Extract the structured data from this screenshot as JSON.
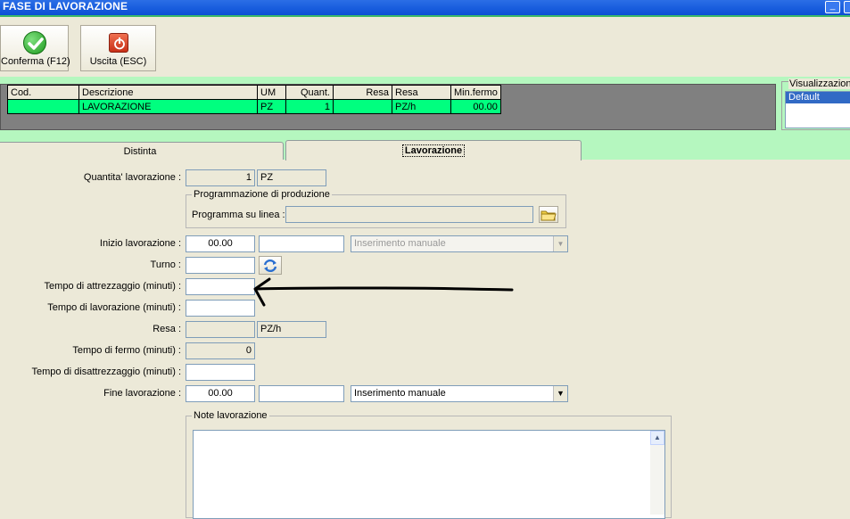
{
  "window": {
    "title": "FASE DI LAVORAZIONE"
  },
  "toolbar": {
    "confirm_label": "Conferma (F12)",
    "exit_label": "Uscita (ESC)"
  },
  "grid": {
    "headers": [
      "Cod.",
      "Descrizione",
      "UM",
      "Quant.",
      "Resa",
      "Resa",
      "Min.fermo"
    ],
    "row": {
      "cod": "",
      "descrizione": "LAVORAZIONE",
      "um": "PZ",
      "quant": "1",
      "resa": "",
      "resa_um": "PZ/h",
      "min_fermo": "00.00"
    }
  },
  "visualizzazione": {
    "label": "Visualizzazione",
    "selected": "Default"
  },
  "tabs": [
    {
      "label": "Distinta"
    },
    {
      "label": "Lavorazione"
    }
  ],
  "form": {
    "quantita_label": "Quantita' lavorazione :",
    "quantita_value": "1",
    "quantita_um": "PZ",
    "programmazione_legend": "Programmazione di produzione",
    "programma_label": "Programma su linea :",
    "programma_value": "",
    "inizio_label": "Inizio lavorazione :",
    "inizio_time": "00.00",
    "inizio_date": "",
    "inizio_mode": "Inserimento manuale",
    "turno_label": "Turno :",
    "turno_value": "",
    "attrezzaggio_label": "Tempo di attrezzaggio (minuti) :",
    "attrezzaggio_value": "",
    "lavorazione_label": "Tempo di lavorazione (minuti) :",
    "lavorazione_value": "",
    "resa_label": "Resa :",
    "resa_value": "",
    "resa_um": "PZ/h",
    "fermo_label": "Tempo di fermo (minuti) :",
    "fermo_value": "0",
    "disattrezzaggio_label": "Tempo di disattrezzaggio (minuti) :",
    "disattrezzaggio_value": "",
    "fine_label": "Fine lavorazione :",
    "fine_time": "00.00",
    "fine_date": "",
    "fine_mode": "Inserimento manuale",
    "note_legend": "Note lavorazione",
    "note_value": ""
  },
  "colors": {
    "accent_green": "#00ff7f",
    "band_green": "#b5f7bf",
    "selection": "#316ac5"
  },
  "icons": [
    "check-icon",
    "power-icon",
    "folder-icon",
    "refresh-icon",
    "arrow-annotation"
  ]
}
